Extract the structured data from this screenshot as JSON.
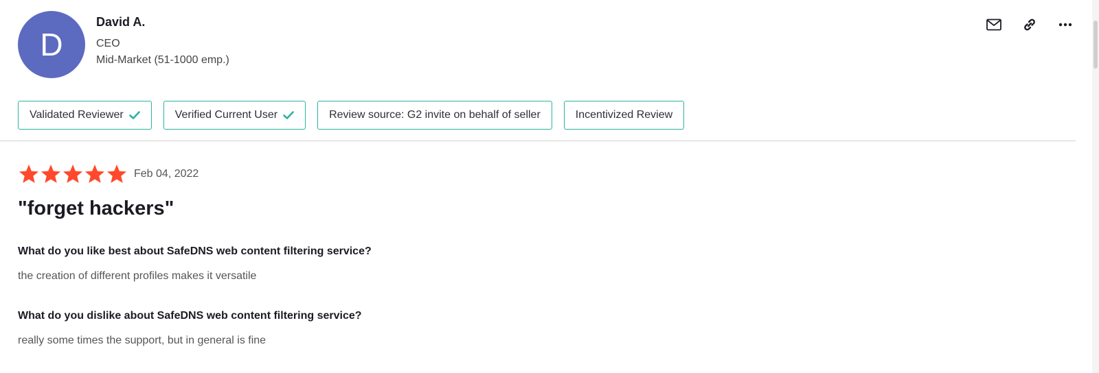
{
  "reviewer": {
    "initial": "D",
    "name": "David A.",
    "title": "CEO",
    "segment": "Mid-Market (51-1000 emp.)",
    "avatar_color": "#5c6bc0"
  },
  "actions": [
    "envelope-icon",
    "link-icon",
    "more-icon"
  ],
  "badges": [
    {
      "label": "Validated Reviewer",
      "verified": true
    },
    {
      "label": "Verified Current User",
      "verified": true
    },
    {
      "label": "Review source: G2 invite on behalf of seller",
      "verified": false
    },
    {
      "label": "Incentivized Review",
      "verified": false
    }
  ],
  "review": {
    "rating": 5,
    "max_rating": 5,
    "date": "Feb 04, 2022",
    "title": "\"forget hackers\"",
    "qa": [
      {
        "question": "What do you like best about SafeDNS web content filtering service?",
        "answer": "the creation of different profiles makes it versatile"
      },
      {
        "question": "What do you dislike about SafeDNS web content filtering service?",
        "answer": "really some times the support, but in general is fine"
      }
    ]
  },
  "colors": {
    "accent": "#2ab3a0",
    "star": "#ff492c",
    "text": "#1b1b24"
  }
}
